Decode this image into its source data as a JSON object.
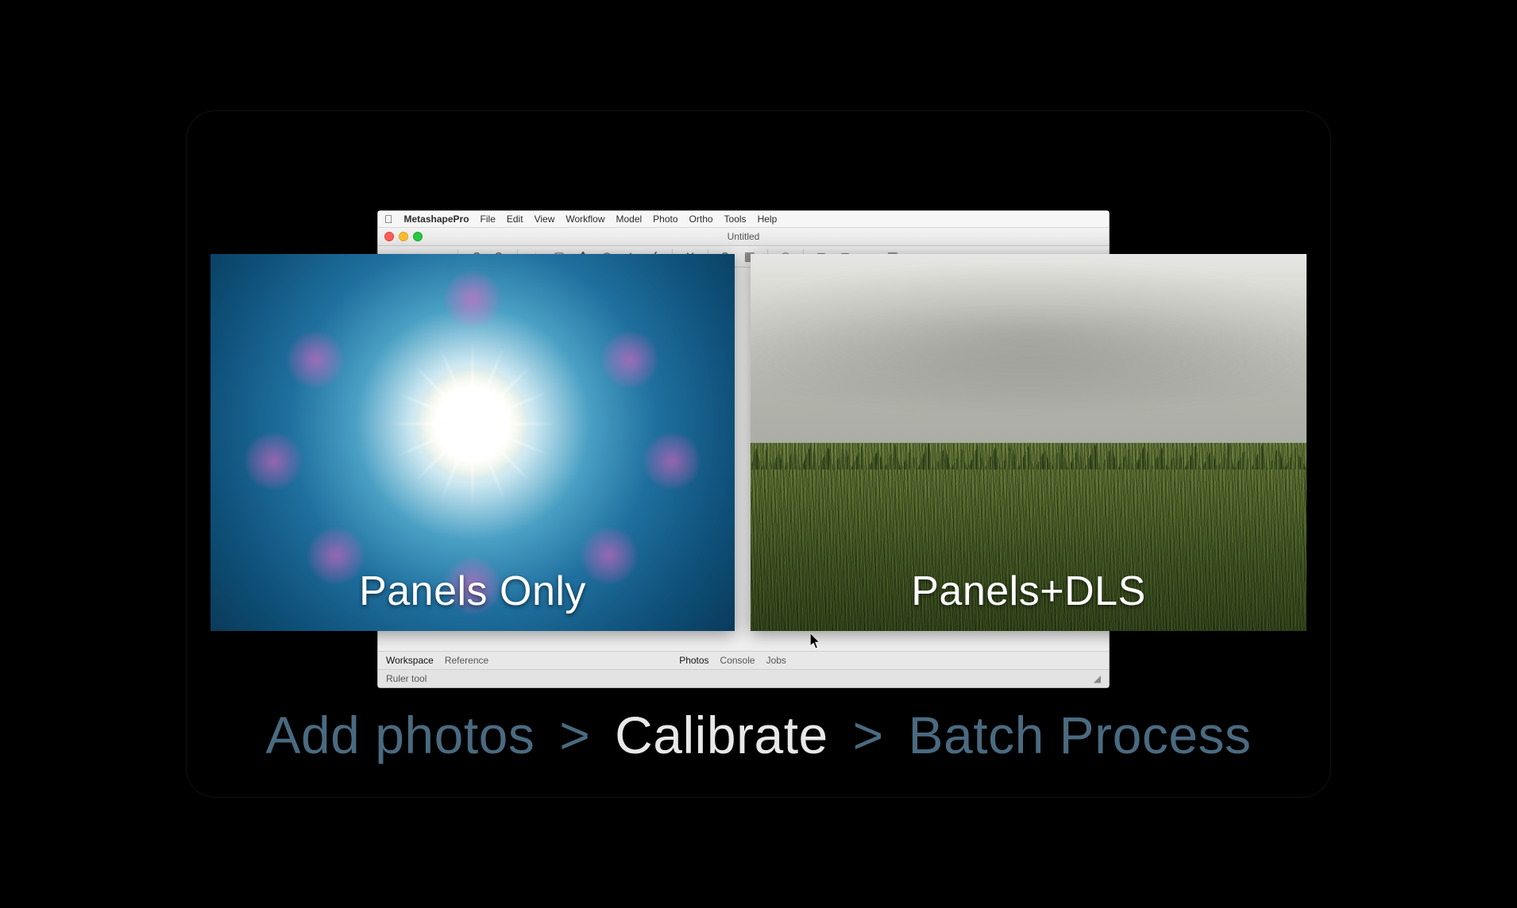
{
  "menu": {
    "app_name": "MetashapePro",
    "items": [
      "File",
      "Edit",
      "View",
      "Workflow",
      "Model",
      "Photo",
      "Ortho",
      "Tools",
      "Help"
    ]
  },
  "window": {
    "title": "Untitled"
  },
  "left_tabs": {
    "workspace": "Workspace",
    "reference": "Reference"
  },
  "bottom_tabs": {
    "photos": "Photos",
    "console": "Console",
    "jobs": "Jobs"
  },
  "status": {
    "text": "Ruler tool"
  },
  "overlay": {
    "left_caption": "Panels Only",
    "right_caption": "Panels+DLS"
  },
  "breadcrumb": {
    "step1": "Add photos",
    "step2": "Calibrate",
    "step3": "Batch Process",
    "separator": ">"
  }
}
